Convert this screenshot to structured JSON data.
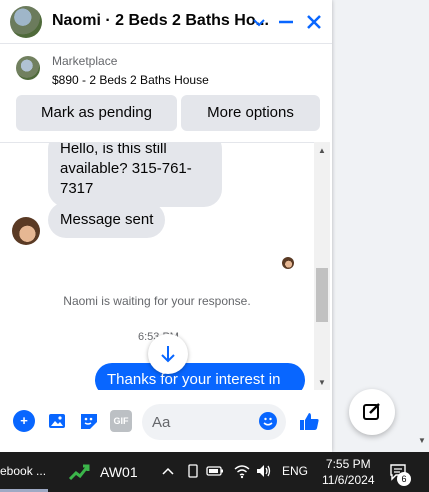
{
  "chat": {
    "title": "Naomi · 2 Beds 2 Baths Ho...",
    "listing": {
      "category": "Marketplace",
      "title": "$890 - 2 Beds 2 Baths House"
    },
    "actions": {
      "mark_pending": "Mark as pending",
      "more_options": "More options"
    },
    "messages": {
      "incoming_1": "Hello, is this still available? 315-761-7317",
      "incoming_2": "Message sent",
      "status": "Naomi is waiting for your response.",
      "timestamp": "6:53 PM",
      "outgoing_1": "Thanks for your interest in"
    },
    "composer": {
      "placeholder": "Aa"
    },
    "icons": [
      "house-avatar",
      "chevron-down-icon",
      "minimize-icon",
      "close-icon",
      "plus-icon",
      "image-icon",
      "sticker-icon",
      "gif-icon",
      "emoji-icon",
      "like-icon",
      "scroll-down-icon",
      "new-message-icon"
    ]
  },
  "taskbar": {
    "app_label": "ebook ...",
    "aw_label": "AW01",
    "language": "ENG",
    "time": "7:55 PM",
    "date": "11/6/2024",
    "notification_count": "6"
  },
  "colors": {
    "accent": "#0866ff",
    "bubble_in": "#e4e6eb",
    "taskbar": "#1c1c1c"
  }
}
